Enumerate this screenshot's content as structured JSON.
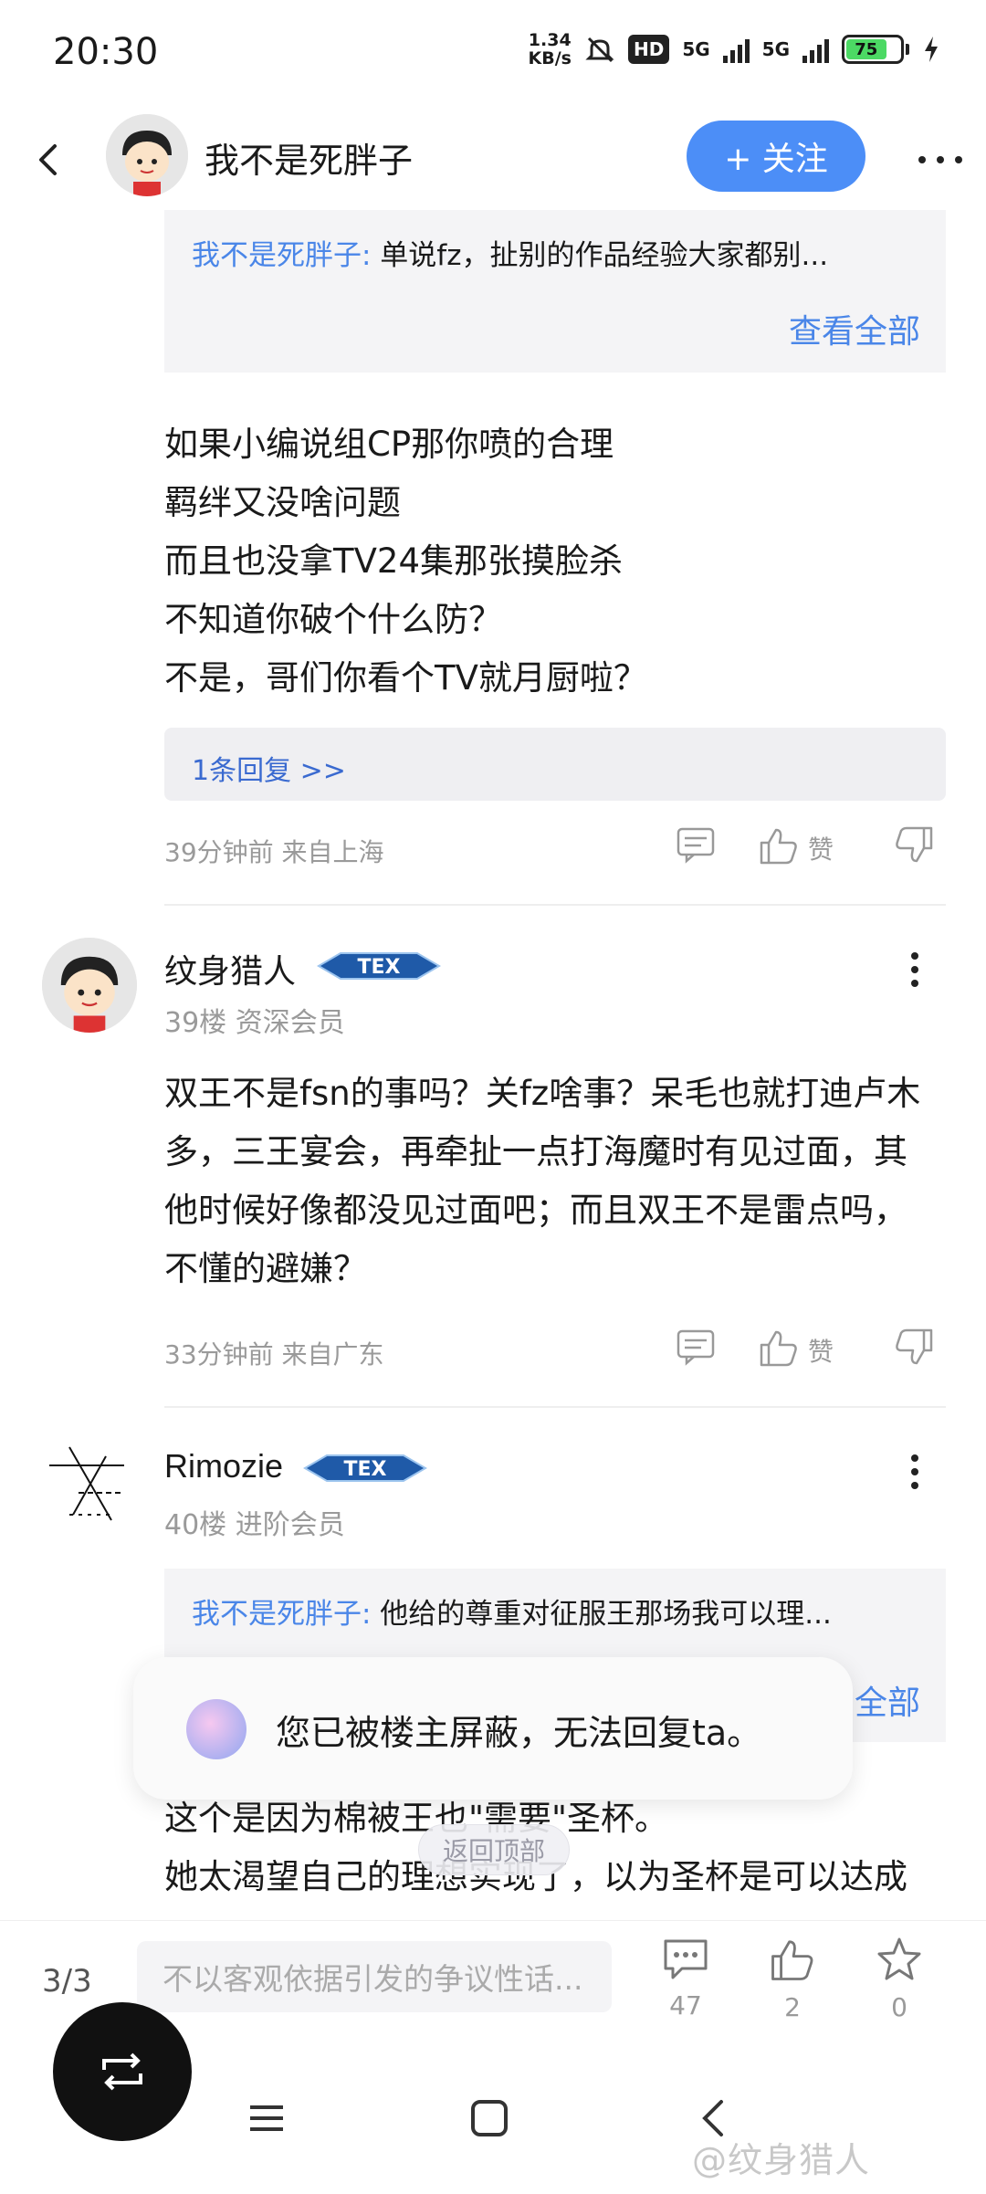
{
  "status_bar": {
    "time": "20:30",
    "net_speed_value": "1.34",
    "net_speed_unit": "KB/s",
    "hd_label": "HD",
    "signal1": "5G",
    "signal2": "5G",
    "battery": "75"
  },
  "header": {
    "author_name": "我不是死胖子",
    "follow_label": "+ 关注"
  },
  "post": {
    "quote_user": "我不是死胖子:",
    "quote_text": " 单说fz，扯别的作品经验大家都别...",
    "view_all": "查看全部",
    "body": "如果小编说组CP那你喷的合理\n羁绊又没啥问题\n而且也没拿TV24集那张摸脸杀\n不知道你破个什么防？\n不是，哥们你看个TV就月厨啦？",
    "reply_link": "1条回复 >>",
    "meta": "39分钟前  来自上海",
    "like_label": "赞"
  },
  "comments": [
    {
      "name": "纹身猎人",
      "badge": "TEX",
      "floor": "39楼  资深会员",
      "body": "双王不是fsn的事吗？关fz啥事？呆毛也就打迪卢木多，三王宴会，再牵扯一点打海魔时有见过面，其他时候好像都没见过面吧；而且双王不是雷点吗，不懂的避嫌？",
      "meta": "33分钟前  来自广东",
      "like_label": "赞"
    },
    {
      "name": "Rimozie",
      "badge": "TEX",
      "floor": "40楼  进阶会员",
      "quote_user": "我不是死胖子:",
      "quote_text": " 他给的尊重对征服王那场我可以理...",
      "view_all": "全部",
      "body": "这个是因为棉被王也\"需要\"圣杯。\n她太渴望自己的理想实现了，以为圣杯是可以达成"
    }
  ],
  "toast": {
    "text": "您已被楼主屏蔽，无法回复ta。"
  },
  "back_to_top": "返回顶部",
  "bottom_bar": {
    "page_indicator": "3/3",
    "input_placeholder": "不以客观依据引发的争议性话...",
    "comments_count": "47",
    "likes_count": "2",
    "favorites_count": "0"
  },
  "watermark": "@纹身猎人"
}
